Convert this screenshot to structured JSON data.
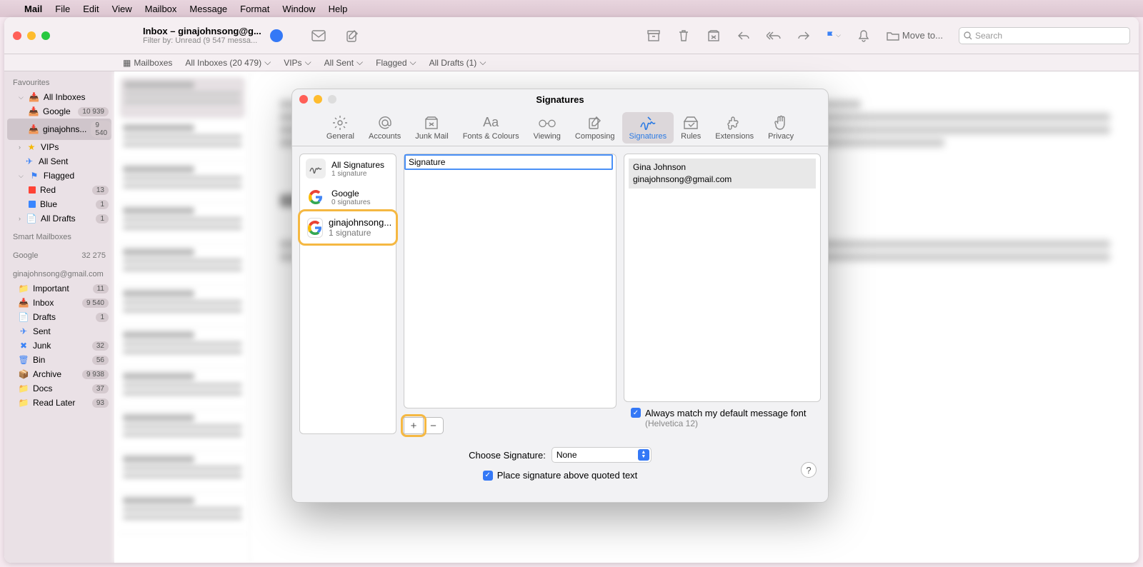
{
  "menubar": {
    "app": "Mail",
    "items": [
      "File",
      "Edit",
      "View",
      "Mailbox",
      "Message",
      "Format",
      "Window",
      "Help"
    ]
  },
  "titlebar": {
    "title": "Inbox – ginajohnsong@g...",
    "subtitle": "Filter by: Unread (9 547 messa...",
    "moveto": "Move to...",
    "searchPlaceholder": "Search"
  },
  "filterrow": {
    "mailboxes": "Mailboxes",
    "allInboxes": "All Inboxes (20 479)",
    "vips": "VIPs",
    "allSent": "All Sent",
    "flagged": "Flagged",
    "allDrafts": "All Drafts (1)"
  },
  "sidebar": {
    "favourites": "Favourites",
    "allInboxes": "All Inboxes",
    "google": "Google",
    "googleCount": "10 939",
    "ginaLabel": "ginajohns...",
    "ginaCount": "9 540",
    "vips": "VIPs",
    "allSent": "All Sent",
    "flagged": "Flagged",
    "red": "Red",
    "redCount": "13",
    "blue": "Blue",
    "blueCount": "1",
    "allDrafts": "All Drafts",
    "draftsCount": "1",
    "smart": "Smart Mailboxes",
    "googleSection": "Google",
    "googleSectionCount": "32 275",
    "account": "ginajohnsong@gmail.com",
    "important": "Important",
    "importantCount": "11",
    "inbox": "Inbox",
    "inboxCount": "9 540",
    "drafts": "Drafts",
    "draftsCount2": "1",
    "sent": "Sent",
    "junk": "Junk",
    "junkCount": "32",
    "bin": "Bin",
    "binCount": "56",
    "archive": "Archive",
    "archiveCount": "9 938",
    "docs": "Docs",
    "docsCount": "37",
    "readLater": "Read Later",
    "readLaterCount": "93"
  },
  "pref": {
    "title": "Signatures",
    "tabs": {
      "general": "General",
      "accounts": "Accounts",
      "junk": "Junk Mail",
      "fonts": "Fonts & Colours",
      "viewing": "Viewing",
      "composing": "Composing",
      "signatures": "Signatures",
      "rules": "Rules",
      "extensions": "Extensions",
      "privacy": "Privacy"
    },
    "accounts": {
      "all": {
        "label": "All Signatures",
        "sub": "1 signature"
      },
      "google": {
        "label": "Google",
        "sub": "0 signatures"
      },
      "gina": {
        "label": "ginajohnsong...",
        "sub": "1 signature"
      }
    },
    "sigNameValue": "Signature",
    "plus": "+",
    "minus": "−",
    "preview": {
      "l1": "Gina Johnson",
      "l2": "ginajohnsong@gmail.com"
    },
    "alwaysMatch": "Always match my default message font",
    "fontHint": "(Helvetica 12)",
    "chooseLabel": "Choose Signature:",
    "chooseValue": "None",
    "placeAbove": "Place signature above quoted text",
    "help": "?"
  }
}
